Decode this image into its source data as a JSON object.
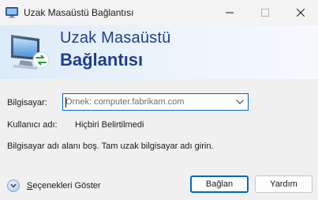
{
  "window": {
    "title": "Uzak Masaüstü Bağlantısı"
  },
  "banner": {
    "line1": "Uzak Masaüstü",
    "line2": "Bağlantısı"
  },
  "form": {
    "computer_label": "Bilgisayar:",
    "computer_value": "",
    "computer_placeholder": "Örnek: computer.fabrikam.com",
    "username_label": "Kullanıcı adı:",
    "username_value": "Hiçbiri Belirtilmedi",
    "message": "Bilgisayar adı alanı boş. Tam uzak bilgisayar adı girin."
  },
  "footer": {
    "options_label_hotkey": "S",
    "options_label_rest": "eçenekleri Göster",
    "connect_label": "Bağlan",
    "help_label": "Yardım"
  },
  "icons": {
    "app": "remote-desktop-icon",
    "banner": "remote-desktop-logo-icon",
    "dropdown": "chevron-down-icon",
    "options": "expand-circle-icon"
  },
  "colors": {
    "accent": "#0067c0",
    "banner_text": "#1f3f8e"
  }
}
